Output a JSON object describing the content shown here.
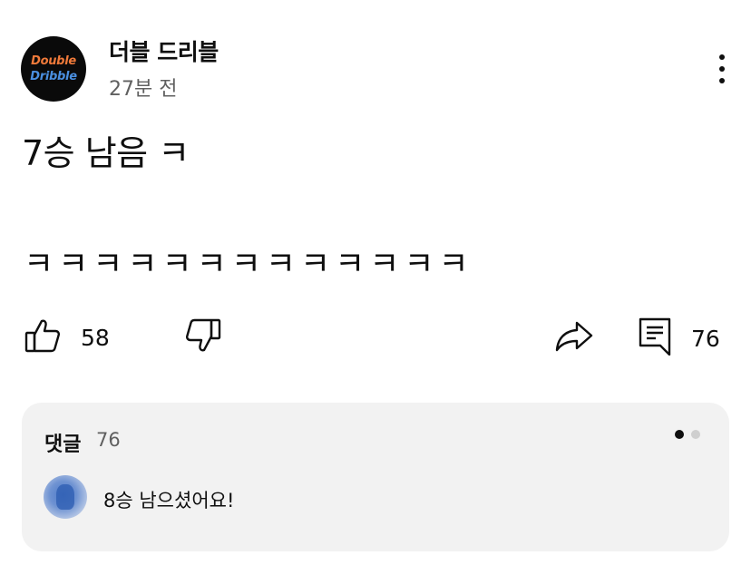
{
  "header": {
    "avatar_line1": "Double",
    "avatar_line2": "Dribble",
    "channel_name": "더블 드리블",
    "timestamp": "27분 전",
    "more_icon": "vertical-ellipsis-icon"
  },
  "post": {
    "title": "7승 남음 ㅋ",
    "body": "ㅋㅋㅋㅋㅋㅋㅋㅋㅋㅋㅋㅋㅋ"
  },
  "actions": {
    "like_icon": "thumbs-up-icon",
    "like_count": "58",
    "dislike_icon": "thumbs-down-icon",
    "share_icon": "share-arrow-icon",
    "comment_icon": "comment-icon",
    "comment_count": "76"
  },
  "comments": {
    "label": "댓글",
    "count": "76",
    "pager": {
      "total": 2,
      "active_index": 0
    },
    "top_comment": {
      "text": "8승 남으셨어요!"
    }
  },
  "colors": {
    "text": "#0f0f0f",
    "secondary_text": "#606060",
    "card_background": "#f2f2f2",
    "avatar_orange": "#f07a3a",
    "avatar_blue": "#4a8fe0"
  }
}
